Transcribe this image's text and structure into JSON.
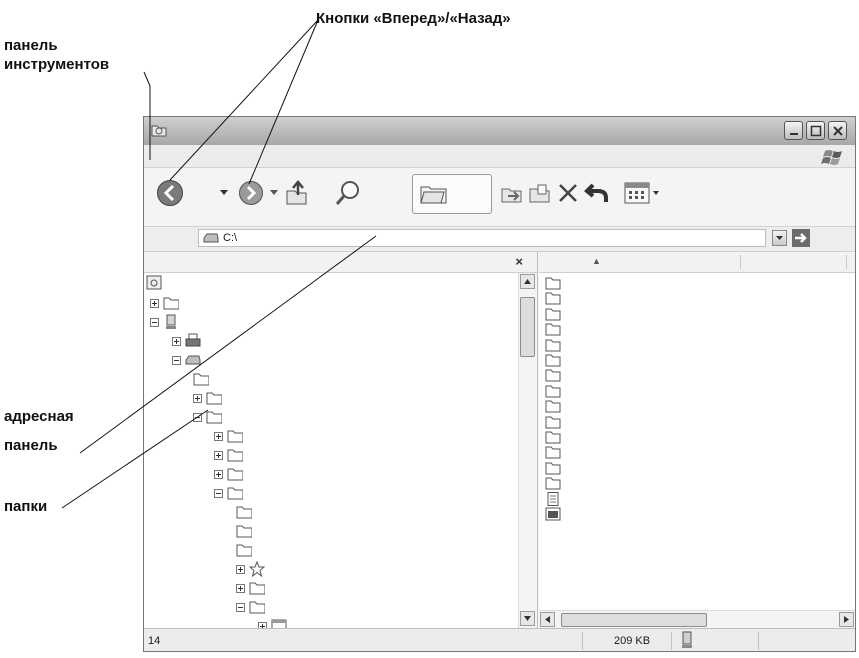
{
  "callouts": {
    "toolbar": "панель\nинструментов",
    "toolbar_line1": "панель",
    "toolbar_line2": "инструментов",
    "nav_buttons": "Кнопки «Вперед»/«Назад»",
    "address_line1": "адресная",
    "address_line2": "панель",
    "folders": "папки"
  },
  "address": {
    "path": "C:\\"
  },
  "left_pane": {
    "close_glyph": "×"
  },
  "status": {
    "count": "14",
    "size": "209 KB"
  },
  "icons": {
    "title": "explorer-folder-icon",
    "windows_logo": "windows-flag-icon",
    "back": "back-arrow-icon",
    "forward": "forward-arrow-icon",
    "up": "up-folder-icon",
    "search": "search-icon",
    "folders": "folders-icon",
    "move_to": "move-to-icon",
    "copy_to": "copy-to-icon",
    "delete": "delete-icon",
    "undo": "undo-icon",
    "views": "views-icon",
    "drive": "drive-icon",
    "computer": "computer-icon"
  },
  "colors": {
    "background": "#ffffff",
    "window_chrome": "#b5b5b5",
    "callout_text": "#111111"
  }
}
